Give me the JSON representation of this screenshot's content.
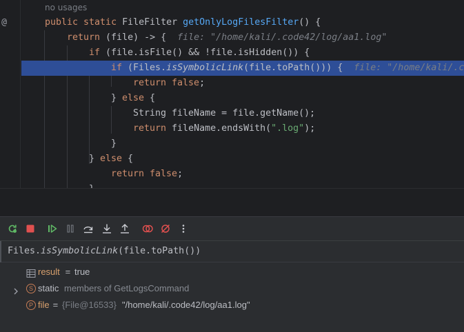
{
  "editor": {
    "usages_hint": "no usages",
    "gutter_icon": "@",
    "lines": [
      {
        "tokens": [
          [
            "kw",
            "public static "
          ],
          [
            "",
            "FileFilter "
          ],
          [
            "fn",
            "getOnlyLogFilesFilter"
          ],
          [
            "",
            "() {"
          ]
        ]
      },
      {
        "tokens": [
          [
            "kw",
            "return "
          ],
          [
            "",
            "(file) -> {  "
          ]
        ],
        "hint": "file: \"/home/kali/.code42/log/aa1.log\""
      },
      {
        "tokens": [
          [
            "kw",
            "if "
          ],
          [
            "",
            "(file.isFile() && !file.isHidden()) {"
          ]
        ]
      },
      {
        "tokens": [
          [
            "kw",
            "if "
          ],
          [
            "",
            "(Files."
          ],
          [
            "it",
            "isSymbolicLink"
          ],
          [
            "",
            "(file.toPath())) {  "
          ]
        ],
        "hint": "file: \"/home/kali/.c"
      },
      {
        "tokens": [
          [
            "kw",
            "return false"
          ],
          [
            "",
            ";"
          ]
        ]
      },
      {
        "tokens": [
          [
            "",
            "} "
          ],
          [
            "kw",
            "else "
          ],
          [
            "",
            "{"
          ]
        ]
      },
      {
        "tokens": [
          [
            "",
            "String fileName = file.getName();"
          ]
        ]
      },
      {
        "tokens": [
          [
            "kw",
            "return "
          ],
          [
            "",
            "fileName.endsWith("
          ],
          [
            "str",
            "\".log\""
          ],
          [
            "",
            ");"
          ]
        ]
      },
      {
        "tokens": [
          [
            "",
            "}"
          ]
        ]
      },
      {
        "tokens": [
          [
            "",
            "} "
          ],
          [
            "kw",
            "else "
          ],
          [
            "",
            "{"
          ]
        ]
      },
      {
        "tokens": [
          [
            "kw",
            "return false"
          ],
          [
            "",
            ";"
          ]
        ]
      },
      {
        "tokens": [
          [
            "",
            "}"
          ]
        ]
      }
    ]
  },
  "toolbar": {
    "buttons": [
      "rerun-icon",
      "stop-icon",
      "resume-icon",
      "pause-icon",
      "step-over-icon",
      "step-into-icon",
      "step-out-icon",
      "view-breakpoints-icon",
      "mute-breakpoints-icon",
      "more-options-icon"
    ]
  },
  "evaluate": {
    "prefix": "Files.",
    "method": "isSymbolicLink",
    "suffix": "(file.toPath())"
  },
  "variables": [
    {
      "icon": "table-icon",
      "name": "result",
      "sep": " = ",
      "value": "true",
      "ref": ""
    },
    {
      "icon": "static-icon",
      "icon_letter": "S",
      "name": "static",
      "sep": " ",
      "value": "members of GetLogsCommand",
      "ref": ""
    },
    {
      "icon": "parameter-icon",
      "icon_letter": "P",
      "name": "file",
      "sep": " = ",
      "ref": "{File@16533}",
      "value": "\"/home/kali/.code42/log/aa1.log\""
    }
  ],
  "colors": {
    "editor_bg": "#1e1f22",
    "panel_bg": "#2b2d30",
    "highlight": "#2e4e97",
    "keyword": "#cf8e6d",
    "function": "#56a8f5",
    "string": "#6aab73",
    "hint": "#7a7e85"
  }
}
